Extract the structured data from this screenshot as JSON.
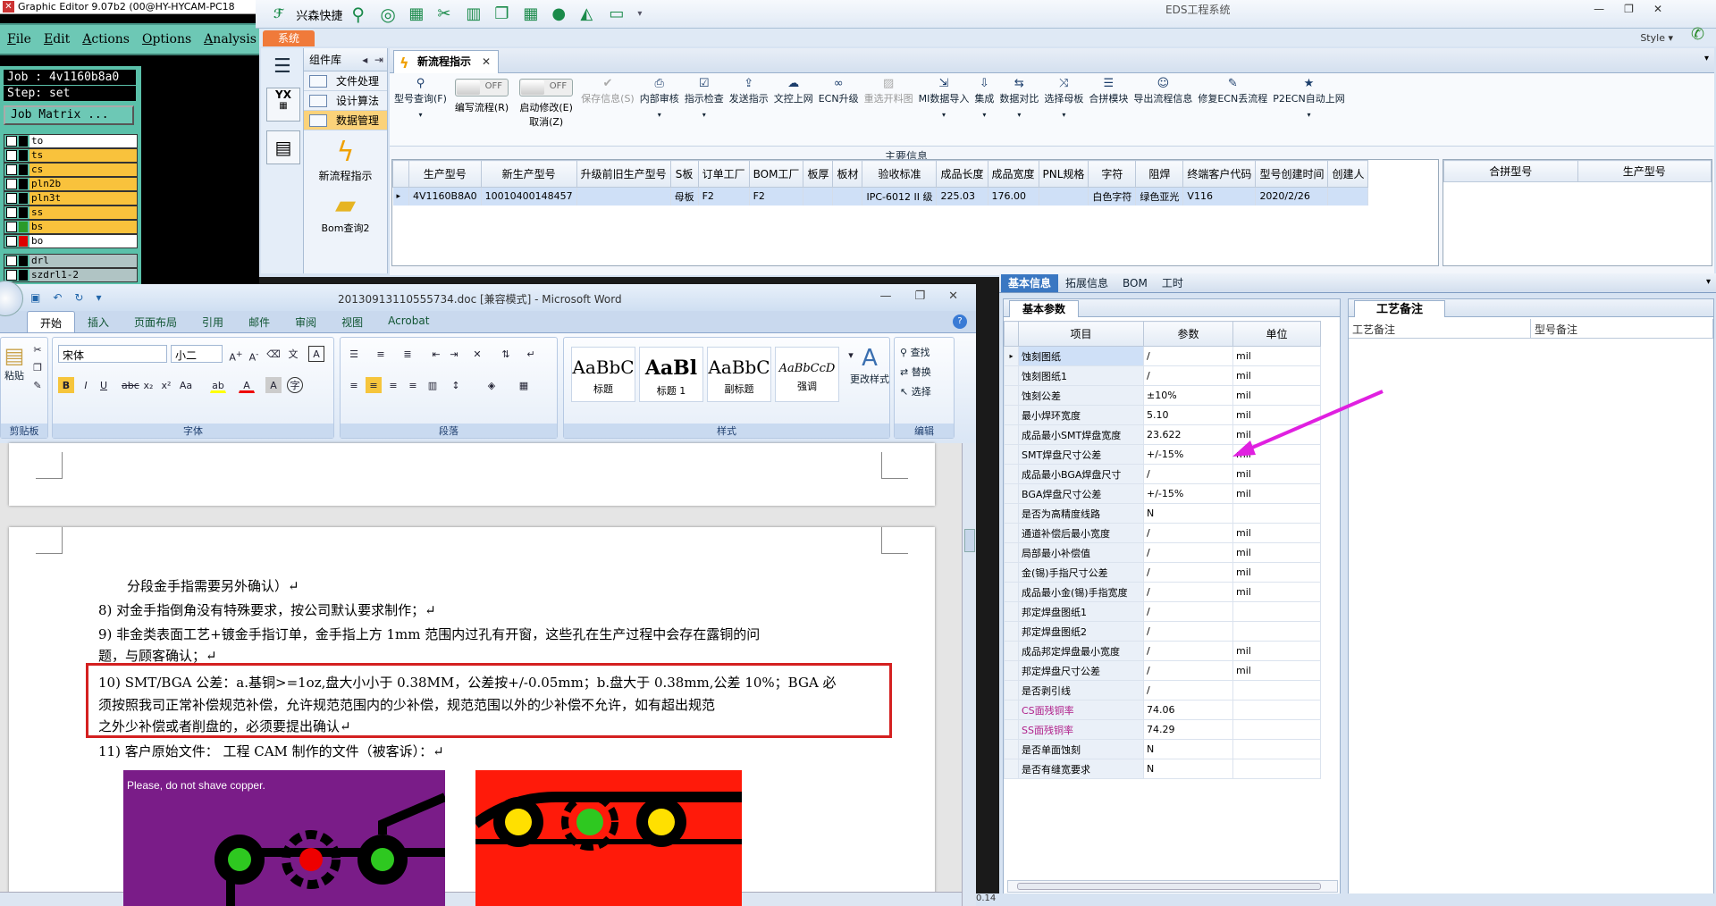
{
  "graphic_editor": {
    "title": "Graphic Editor 9.07b2 (00@HY-HYCAM-PC18",
    "menu": [
      "File",
      "Edit",
      "Actions",
      "Options",
      "Analysis"
    ],
    "job": "Job : 4v1160b8a0",
    "step": "Step: set",
    "job_matrix": "Job Matrix ...",
    "layers": [
      {
        "name": "to",
        "color": "#ffffff"
      },
      {
        "name": "ts",
        "color": "#f9c23c"
      },
      {
        "name": "cs",
        "color": "#f9c23c"
      },
      {
        "name": "pln2b",
        "color": "#f9c23c"
      },
      {
        "name": "pln3t",
        "color": "#f9c23c"
      },
      {
        "name": "ss",
        "color": "#f9c23c"
      },
      {
        "name": "bs",
        "color": "#f9c23c"
      },
      {
        "name": "bo",
        "color": "#ffffff"
      },
      {
        "name": "drl",
        "color": "#b0c4c4"
      },
      {
        "name": "szdrl1-2",
        "color": "#b0c4c4"
      }
    ]
  },
  "eds": {
    "quick_label": "兴森快捷",
    "title": "EDS工程系统",
    "style_label": "Style",
    "sys_tab": "系统",
    "complib": {
      "header": "组件库",
      "items": [
        "文件处理",
        "设计算法",
        "数据管理"
      ],
      "big_items": [
        "新流程指示",
        "Bom查询2"
      ]
    },
    "doc_tab": "新流程指示",
    "ribbon": [
      {
        "label": "型号查询(F)",
        "icon": "search-icon",
        "disabled": false,
        "dd": true
      },
      {
        "label": "编写流程(R)",
        "toggle": "OFF"
      },
      {
        "label": "启动修改(E)\n取消(Z)",
        "toggle": "OFF"
      },
      {
        "label": "保存信息(S)",
        "icon": "check-icon",
        "disabled": true,
        "dd": false
      },
      {
        "label": "内部审核",
        "icon": "printer-icon",
        "disabled": false,
        "dd": true
      },
      {
        "label": "指示检查",
        "icon": "checklist-icon",
        "disabled": false,
        "dd": true
      },
      {
        "label": "发送指示",
        "icon": "upload-icon",
        "disabled": false,
        "dd": false
      },
      {
        "label": "文控上网",
        "icon": "cloud-icon",
        "disabled": false,
        "dd": false
      },
      {
        "label": "ECN升级",
        "icon": "binoculars-icon",
        "disabled": false,
        "dd": false
      },
      {
        "label": "重选开料图",
        "icon": "image-icon",
        "disabled": true,
        "dd": false
      },
      {
        "label": "MI数据导入",
        "icon": "import-icon",
        "disabled": false,
        "dd": true
      },
      {
        "label": "集成",
        "icon": "download-icon",
        "disabled": false,
        "dd": true
      },
      {
        "label": "数据对比",
        "icon": "compare-icon",
        "disabled": false,
        "dd": true
      },
      {
        "label": "选择母板",
        "icon": "shuffle-icon",
        "disabled": false,
        "dd": true
      },
      {
        "label": "合拼模块",
        "icon": "list-icon",
        "disabled": false,
        "dd": false
      },
      {
        "label": "导出流程信息",
        "icon": "smile-icon",
        "disabled": false,
        "dd": false
      },
      {
        "label": "修复ECN丢流程",
        "icon": "wrench-icon",
        "disabled": false,
        "dd": false
      },
      {
        "label": "P2ECN自动上网",
        "icon": "star-icon",
        "disabled": false,
        "dd": true
      }
    ],
    "main_info_label": "主要信息",
    "grid": {
      "columns": [
        "生产型号",
        "新生产型号",
        "升级前旧生产型号",
        "S板",
        "订单工厂",
        "BOM工厂",
        "板厚",
        "板材",
        "验收标准",
        "成品长度",
        "成品宽度",
        "PNL规格",
        "字符",
        "阻焊",
        "终端客户代码",
        "型号创建时间",
        "创建人"
      ],
      "rows": [
        [
          "4V1160B8A0",
          "10010400148457",
          "",
          "母板",
          "F2",
          "F2",
          "",
          "",
          "IPC-6012 II 级",
          "225.03",
          "176.00",
          "",
          "白色字符",
          "绿色亚光",
          "V116",
          "2020/2/26",
          ""
        ]
      ]
    },
    "grid2": {
      "columns": [
        "合拼型号",
        "生产型号"
      ]
    }
  },
  "right_panel": {
    "tabs": [
      "基本信息",
      "拓展信息",
      "BOM",
      "工时"
    ],
    "basic_title": "基本参数",
    "columns": [
      "项目",
      "参数",
      "单位"
    ],
    "rows": [
      {
        "name": "蚀刻图纸",
        "value": "/",
        "unit": "mil"
      },
      {
        "name": "蚀刻图纸1",
        "value": "/",
        "unit": "mil"
      },
      {
        "name": "蚀刻公差",
        "value": "±10%",
        "unit": "mil"
      },
      {
        "name": "最小焊环宽度",
        "value": "5.10",
        "unit": "mil"
      },
      {
        "name": "成品最小SMT焊盘宽度",
        "value": "23.622",
        "unit": "mil"
      },
      {
        "name": "SMT焊盘尺寸公差",
        "value": "+/-15%",
        "unit": "mil"
      },
      {
        "name": "成品最小BGA焊盘尺寸",
        "value": "/",
        "unit": "mil"
      },
      {
        "name": "BGA焊盘尺寸公差",
        "value": "+/-15%",
        "unit": "mil"
      },
      {
        "name": "是否为高精度线路",
        "value": "N",
        "unit": ""
      },
      {
        "name": "通道补偿后最小宽度",
        "value": "/",
        "unit": "mil"
      },
      {
        "name": "局部最小补偿值",
        "value": "/",
        "unit": "mil"
      },
      {
        "name": "金(锡)手指尺寸公差",
        "value": "/",
        "unit": "mil"
      },
      {
        "name": "成品最小金(锡)手指宽度",
        "value": "/",
        "unit": "mil"
      },
      {
        "name": "邦定焊盘图纸1",
        "value": "/",
        "unit": ""
      },
      {
        "name": "邦定焊盘图纸2",
        "value": "/",
        "unit": ""
      },
      {
        "name": "成品邦定焊盘最小宽度",
        "value": "/",
        "unit": "mil"
      },
      {
        "name": "邦定焊盘尺寸公差",
        "value": "/",
        "unit": "mil"
      },
      {
        "name": "是否剥引线",
        "value": "/",
        "unit": ""
      },
      {
        "name": "CS面残铜率",
        "value": "74.06",
        "unit": ""
      },
      {
        "name": "SS面残铜率",
        "value": "74.29",
        "unit": ""
      },
      {
        "name": "是否单面蚀刻",
        "value": "N",
        "unit": ""
      },
      {
        "name": "是否有缝宽要求",
        "value": "N",
        "unit": ""
      }
    ],
    "craft_title": "工艺备注",
    "craft_columns": [
      "工艺备注",
      "型号备注"
    ]
  },
  "word": {
    "title": "20130913110555734.doc [兼容模式] - Microsoft Word",
    "tabs": [
      "开始",
      "插入",
      "页面布局",
      "引用",
      "邮件",
      "审阅",
      "视图",
      "Acrobat"
    ],
    "font_name": "宋体",
    "font_size": "小二",
    "groups": [
      "剪贴板",
      "字体",
      "段落",
      "样式",
      "编辑"
    ],
    "paste_label": "粘贴",
    "styles": [
      {
        "sample": "AaBbC",
        "name": "标题"
      },
      {
        "sample": "AaBl",
        "name": "标题 1"
      },
      {
        "sample": "AaBbC",
        "name": "副标题"
      },
      {
        "sample": "AaBbCcD",
        "name": "强调"
      }
    ],
    "change_styles": "更改样式",
    "edit_items": [
      "查找",
      "替换",
      "选择"
    ],
    "doc_lines": [
      "分段金手指需要另外确认）↵",
      "8)   对金手指倒角没有特殊要求，按公司默认要求制作；↵",
      "9)   非金类表面工艺+镀金手指订单，金手指上方 1mm 范围内过孔有开窗，这些孔在生产过程中会存在露铜的问",
      "     题，与顾客确认；↵",
      "10)  SMT/BGA 公差：a.基铜>=1oz,盘大小小于 0.38MM，公差按+/-0.05mm；b.盘大于 0.38mm,公差 10%；BGA 必",
      "     须按照我司正常补偿规范补偿，允许规范范围内的少补偿，规范范围以外的少补偿不允许，如有超出规范",
      "     之外少补偿或者削盘的，必须要提出确认↵",
      "11)                    客户原始文件：                              工程 CAM 制作的文件（被客诉）：↵"
    ],
    "image_caption": "Please, do not shave copper."
  },
  "statusbar": "0.14"
}
